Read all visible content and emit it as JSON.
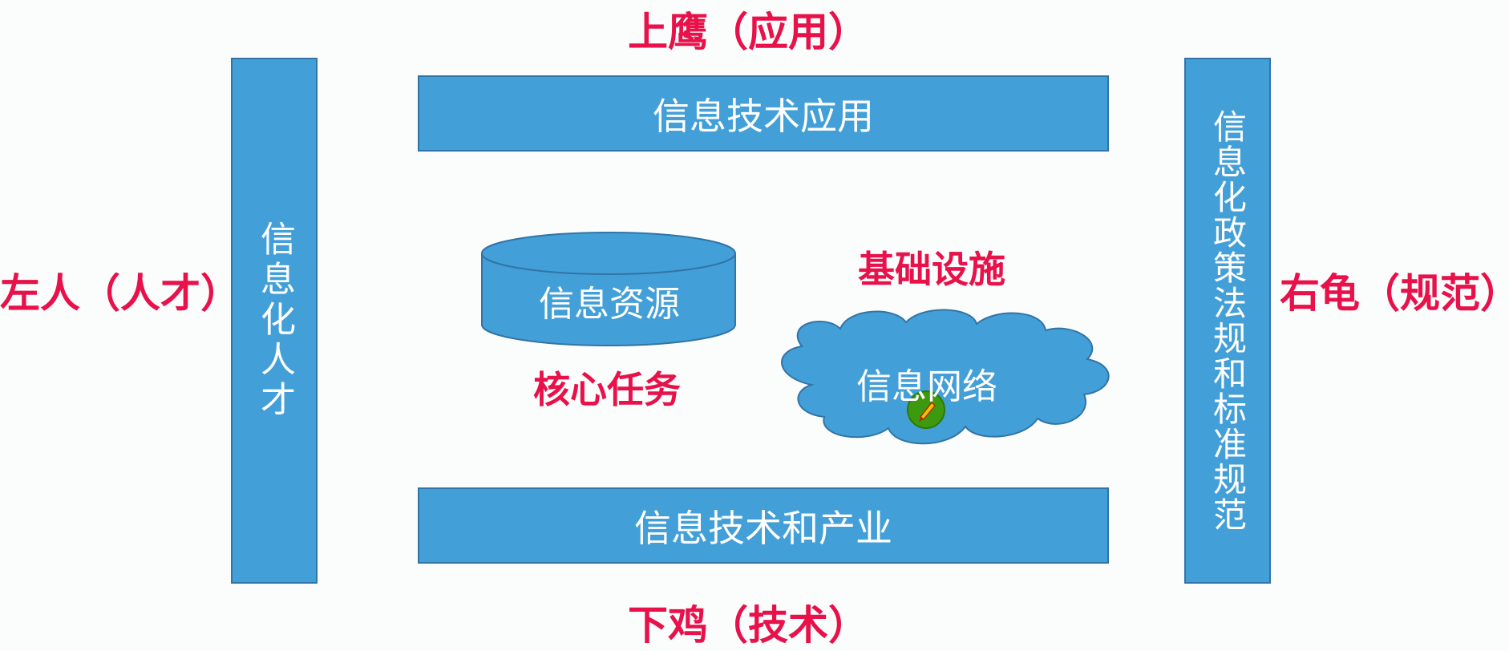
{
  "labels": {
    "top": "上鹰（应用）",
    "bottom": "下鸡（技术）",
    "left": "左人（人才）",
    "right": "右龟（规范）",
    "infrastructure": "基础设施",
    "core_task": "核心任务"
  },
  "boxes": {
    "top_box": "信息技术应用",
    "bottom_box": "信息技术和产业",
    "left_box": "信息化人才",
    "right_box": "信息化政策法规和标准规范",
    "cylinder": "信息资源",
    "cloud": "信息网络"
  },
  "colors": {
    "box_fill": "#439fd7",
    "box_border": "#3274a6",
    "label_red": "#e8114a",
    "cursor_green": "#3d9a0e"
  },
  "icons": {
    "cursor": "pen-cursor-icon"
  }
}
